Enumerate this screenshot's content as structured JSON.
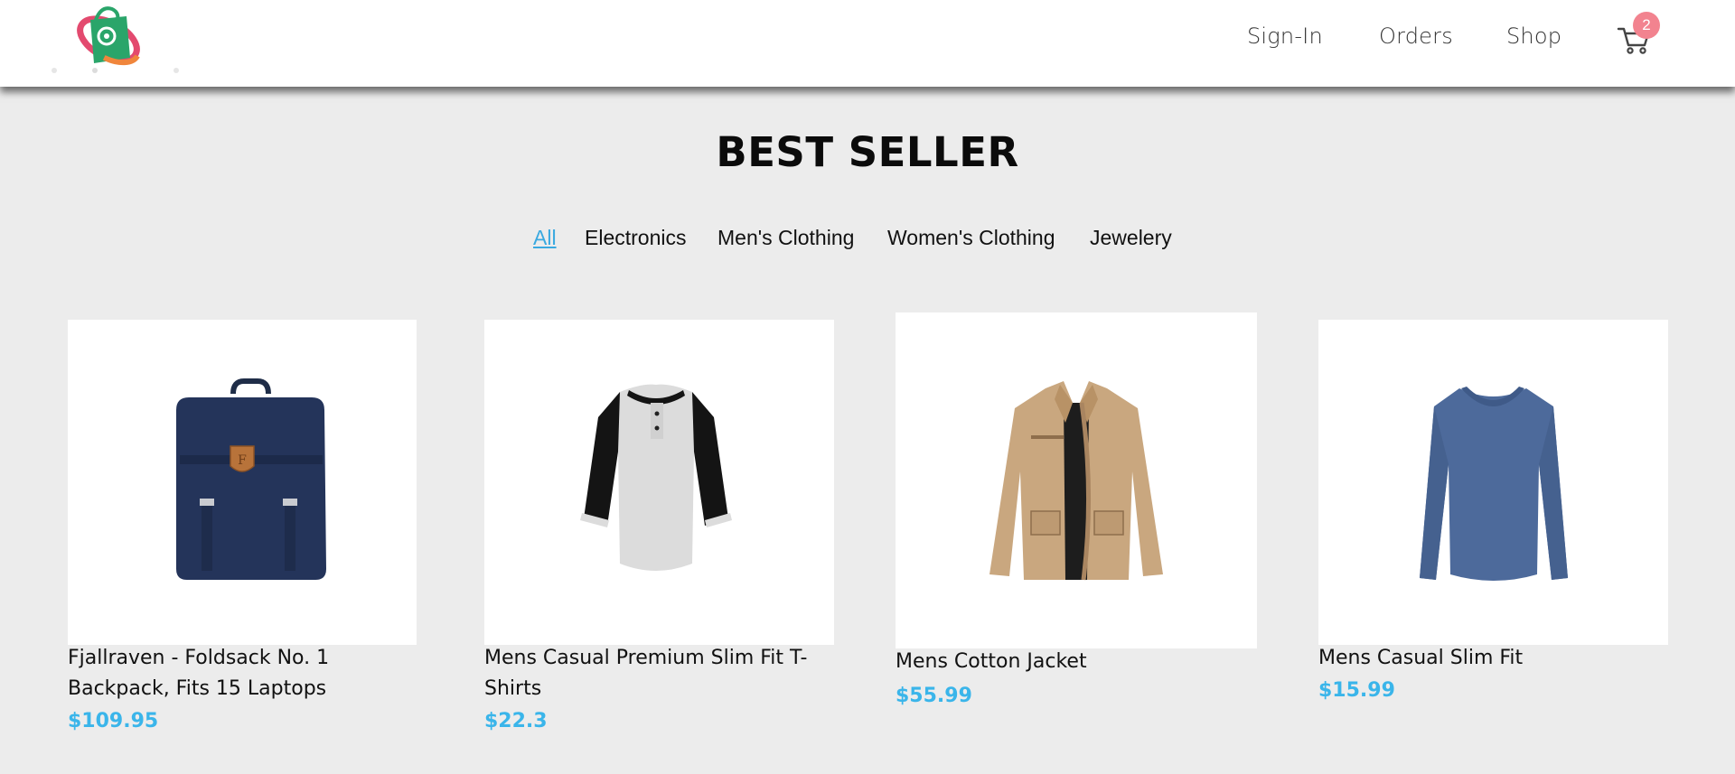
{
  "header": {
    "logo_name": "shopping-bag-logo",
    "nav": [
      {
        "label": "Sign-In"
      },
      {
        "label": "Orders"
      },
      {
        "label": "Shop"
      }
    ],
    "cart_count": "2"
  },
  "section": {
    "title": "BEST SELLER"
  },
  "filters": [
    {
      "label": "All",
      "active": true
    },
    {
      "label": "Electronics",
      "active": false
    },
    {
      "label": "Men's Clothing",
      "active": false
    },
    {
      "label": "Women's Clothing",
      "active": false
    },
    {
      "label": "Jewelery",
      "active": false
    }
  ],
  "products": [
    {
      "title_line1": "Fjallraven - Foldsack No. 1",
      "title_line2": "Backpack, Fits 15 Laptops",
      "price": "$109.95",
      "image": "navy-backpack"
    },
    {
      "title_line1": "Mens Casual Premium Slim Fit T-",
      "title_line2": "Shirts",
      "price": "$22.3",
      "image": "raglan-henley-tshirt"
    },
    {
      "title_line1": "Mens Cotton Jacket",
      "title_line2": "",
      "price": "$55.99",
      "image": "khaki-cotton-jacket"
    },
    {
      "title_line1": "Mens Casual Slim Fit",
      "title_line2": "",
      "price": "$15.99",
      "image": "blue-long-sleeve-shirt"
    }
  ],
  "colors": {
    "accent": "#3aa9e0",
    "price": "#3ab5ea",
    "badge": "#f2838f",
    "page_bg": "#ececec"
  }
}
